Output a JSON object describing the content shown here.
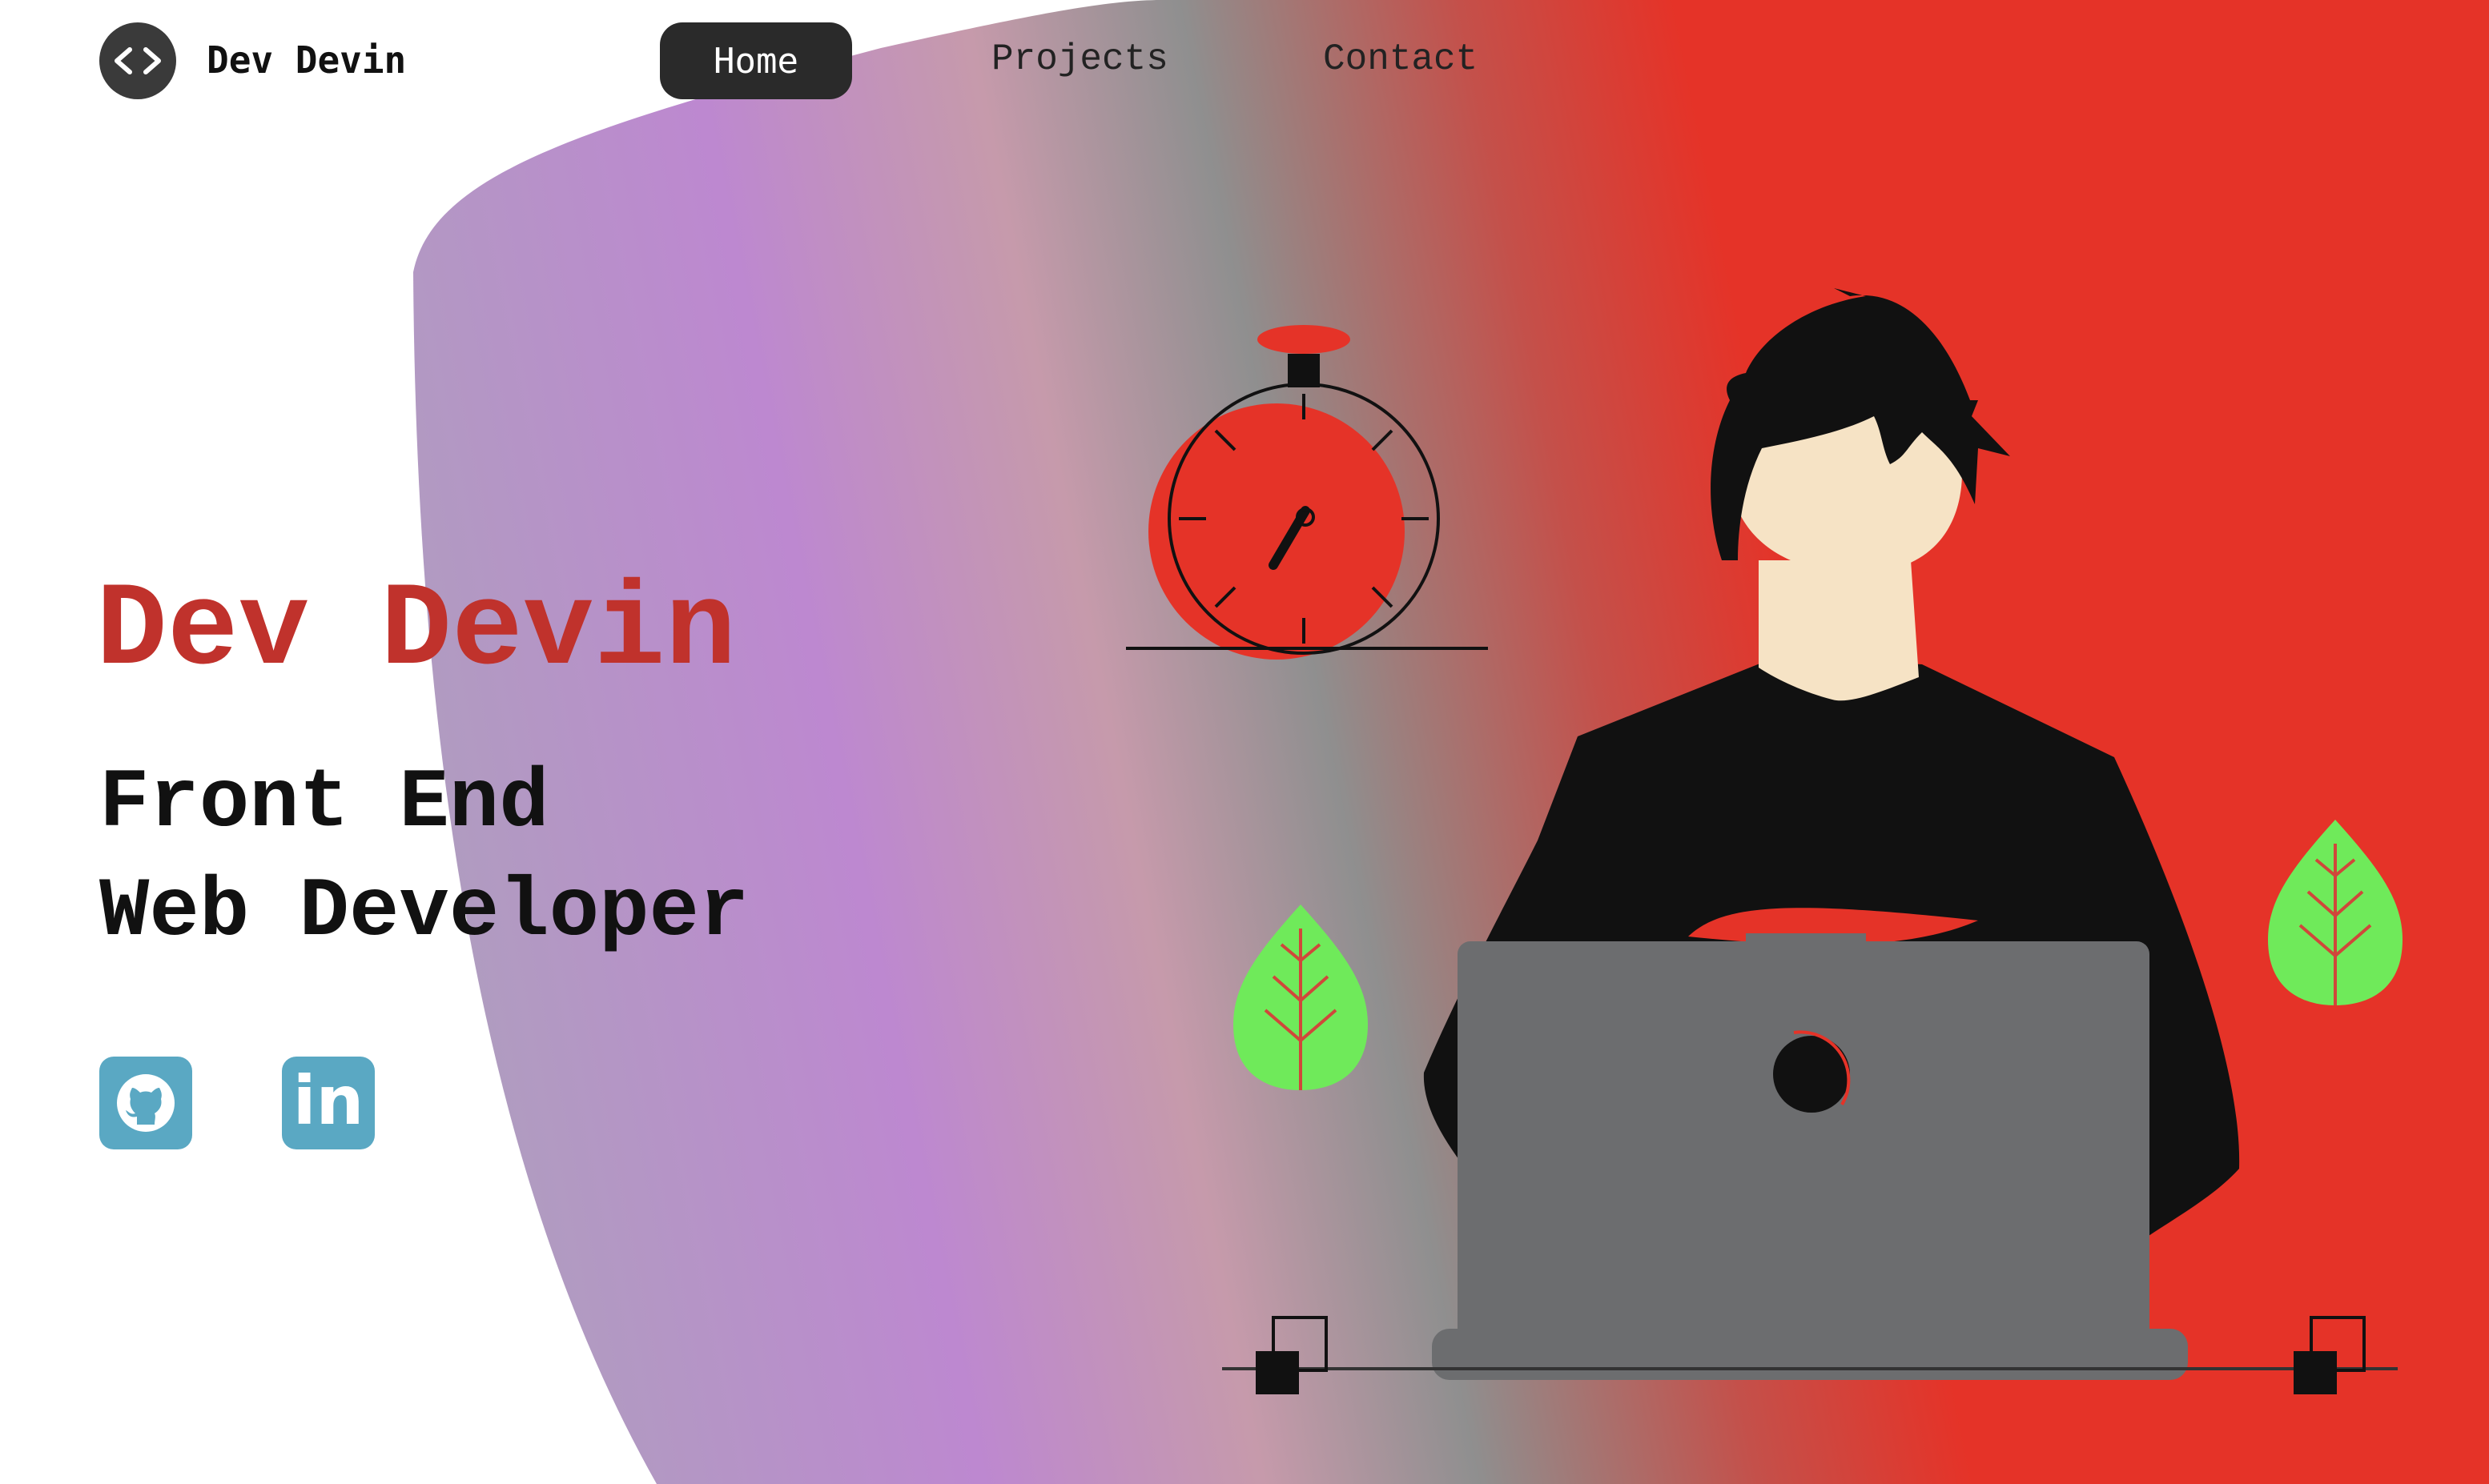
{
  "nav": {
    "logo_icon": "code-brackets-icon",
    "logo_text": "Dev Devin",
    "links": [
      {
        "label": "Home",
        "active": true
      },
      {
        "label": "Projects",
        "active": false
      },
      {
        "label": "Contact",
        "active": false
      }
    ]
  },
  "hero": {
    "name": "Dev Devin",
    "title_line1": "Front End",
    "title_line2": "Web Developer"
  },
  "social": [
    {
      "icon": "github-icon"
    },
    {
      "icon": "linkedin-icon",
      "glyph": "in"
    }
  ],
  "colors": {
    "accent_red": "#c0322c",
    "bg_red": "#e53328",
    "bg_purple": "#bd88d0",
    "social_blue": "#5aa8c3",
    "leaf_green": "#6fea5a",
    "laptop_gray": "#6c6d6f"
  }
}
